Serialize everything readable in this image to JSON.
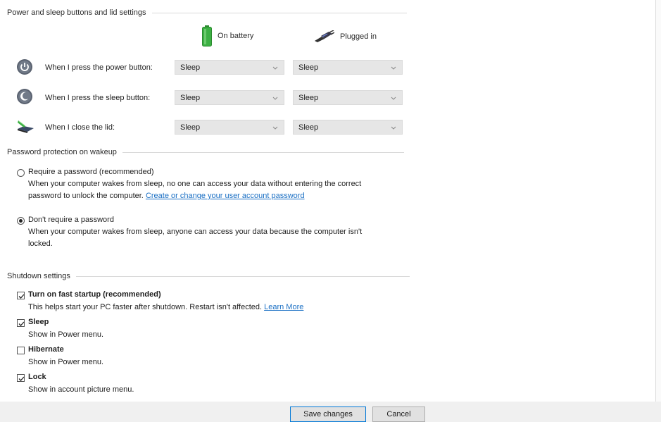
{
  "power": {
    "section_title": "Power and sleep buttons and lid settings",
    "col_battery": "On battery",
    "col_plugged": "Plugged in",
    "rows": [
      {
        "label": "When I press the power button:",
        "battery": "Sleep",
        "plugged": "Sleep"
      },
      {
        "label": "When I press the sleep button:",
        "battery": "Sleep",
        "plugged": "Sleep"
      },
      {
        "label": "When I close the lid:",
        "battery": "Sleep",
        "plugged": "Sleep"
      }
    ]
  },
  "password": {
    "section_title": "Password protection on wakeup",
    "require_label": "Require a password (recommended)",
    "require_desc_1": "When your computer wakes from sleep, no one can access your data without entering the correct",
    "require_desc_2": "password to unlock the computer.",
    "require_link": "Create or change your user account password",
    "norequire_label": "Don't require a password",
    "norequire_desc_1": "When your computer wakes from sleep, anyone can access your data because the computer isn't",
    "norequire_desc_2": "locked.",
    "selected": "norequire"
  },
  "shutdown": {
    "section_title": "Shutdown settings",
    "items": [
      {
        "label": "Turn on fast startup (recommended)",
        "desc": "This helps start your PC faster after shutdown. Restart isn't affected.",
        "link": "Learn More",
        "checked": true
      },
      {
        "label": "Sleep",
        "desc": "Show in Power menu.",
        "checked": true
      },
      {
        "label": "Hibernate",
        "desc": "Show in Power menu.",
        "checked": false
      },
      {
        "label": "Lock",
        "desc": "Show in account picture menu.",
        "checked": true
      }
    ]
  },
  "footer": {
    "save_label": "Save changes",
    "cancel_label": "Cancel"
  },
  "icons": {
    "battery": "battery-icon",
    "plugged": "power-plug-icon",
    "power_button": "power-button-icon",
    "sleep_button": "sleep-button-icon",
    "lid": "laptop-lid-icon"
  },
  "colors": {
    "link": "#1a6fc4",
    "battery_green": "#3cb043",
    "button_accent": "#0078d7"
  }
}
